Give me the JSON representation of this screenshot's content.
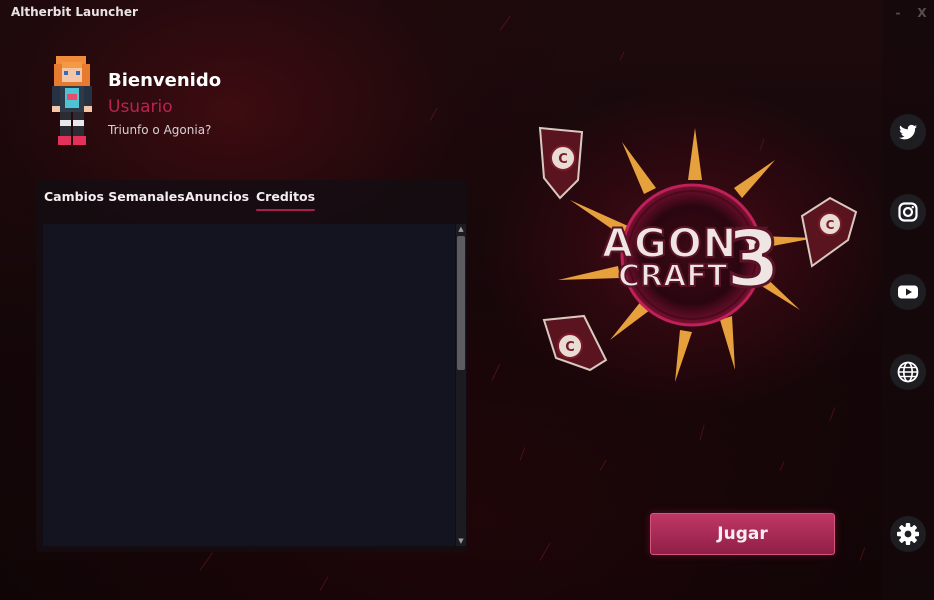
{
  "window": {
    "title": "Altherbit Launcher",
    "minimize_label": "-",
    "close_label": "X"
  },
  "profile": {
    "greeting": "Bienvenido",
    "username": "Usuario",
    "tagline": "Triunfo o Agonia?"
  },
  "news": {
    "tabs": [
      {
        "label": "Cambios Semanales",
        "active": false
      },
      {
        "label": "Anuncios",
        "active": false
      },
      {
        "label": "Creditos",
        "active": true
      }
    ]
  },
  "logo": {
    "line1": "AGONY",
    "line2": "CRAFT",
    "number": "3"
  },
  "play": {
    "label": "Jugar"
  },
  "social": {
    "icons": [
      "twitter-icon",
      "instagram-icon",
      "youtube-icon",
      "globe-icon",
      "gear-icon"
    ]
  },
  "colors": {
    "accent": "#b8244e",
    "play_button": "#a82b55",
    "background": "#160809",
    "logo_spikes": "#e6a13c"
  }
}
